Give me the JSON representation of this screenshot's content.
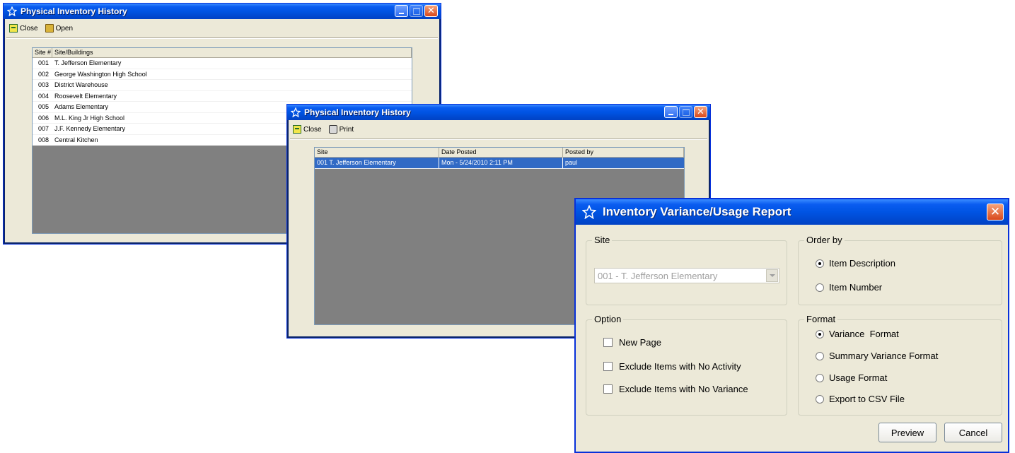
{
  "window1": {
    "title": "Physical Inventory History",
    "toolbar": {
      "close_label": "Close",
      "open_label": "Open"
    },
    "columns": [
      "Site #",
      "Site/Buildings"
    ],
    "rows": [
      {
        "num": "001",
        "name": "T. Jefferson Elementary"
      },
      {
        "num": "002",
        "name": "George Washington High School"
      },
      {
        "num": "003",
        "name": "District Warehouse"
      },
      {
        "num": "004",
        "name": "Roosevelt Elementary"
      },
      {
        "num": "005",
        "name": "Adams Elementary"
      },
      {
        "num": "006",
        "name": "M.L. King Jr High School"
      },
      {
        "num": "007",
        "name": "J.F. Kennedy Elementary"
      },
      {
        "num": "008",
        "name": "Central Kitchen"
      }
    ]
  },
  "window2": {
    "title": "Physical Inventory History",
    "toolbar": {
      "close_label": "Close",
      "print_label": "Print"
    },
    "columns": [
      "Site",
      "Date Posted",
      "Posted by"
    ],
    "rows": [
      {
        "site": "001 T. Jefferson Elementary",
        "date": "Mon - 5/24/2010 2:11 PM",
        "by": "paul"
      }
    ]
  },
  "dialog": {
    "title": "Inventory Variance/Usage Report",
    "site": {
      "legend": "Site",
      "selected": "001 - T. Jefferson Elementary"
    },
    "order_by": {
      "legend": "Order by",
      "options": [
        "Item Description",
        "Item Number"
      ],
      "selected": 0
    },
    "option": {
      "legend": "Option",
      "items": [
        "New Page",
        "Exclude Items with No Activity",
        "Exclude Items with No Variance"
      ],
      "checked": [
        false,
        false,
        false
      ]
    },
    "format": {
      "legend": "Format",
      "options": [
        "Variance  Format",
        "Summary Variance Format",
        "Usage Format",
        "Export to CSV File"
      ],
      "selected": 0
    },
    "preview_label": "Preview",
    "cancel_label": "Cancel"
  },
  "colors": {
    "title_bar": "#0054E3",
    "selection": "#316AC5",
    "window_bg": "#ECE9D8",
    "list_bg": "#808080"
  }
}
